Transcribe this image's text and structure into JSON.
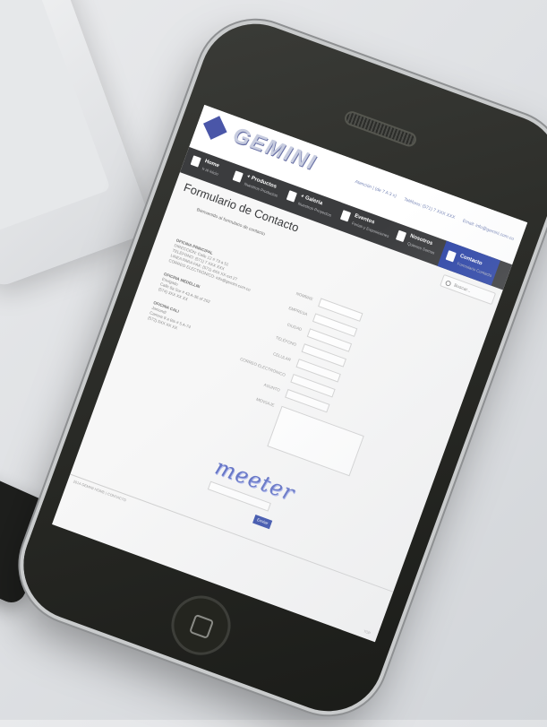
{
  "site": {
    "brand": "GEMINI",
    "header_info": [
      "Atención | (de 7 A 3 x)",
      "Teléfono: (571) 7 XXX XXX",
      "Email: info@gemini.com.co"
    ],
    "search_placeholder": "Buscar...",
    "page_title": "Formulario de Contacto",
    "welcome": "Bienvenido al formulario de contacto"
  },
  "nav": [
    {
      "label": "Home",
      "sub": "Ir al inicio"
    },
    {
      "label": "+ Productos",
      "sub": "Nuestros Productos"
    },
    {
      "label": "+ Galeria",
      "sub": "Nuestros Proyectos"
    },
    {
      "label": "Eventos",
      "sub": "Ferias y Exposiciones"
    },
    {
      "label": "Nosotros",
      "sub": "Quienes Somos"
    },
    {
      "label": "Contacto",
      "sub": "Formulario Contacto"
    }
  ],
  "offices": [
    {
      "title": "OFICINA PRINCIPAL",
      "lines": [
        "DIRECCIÓN: Calle 12 # 73 a 51",
        "TELÉFONO: (571) 7 XXX XXX",
        "LINEA PARA FAX: (571) 4XX XX ext 27",
        "CORREO ELECTRÓNICO: info@gemini.com.co"
      ]
    },
    {
      "title": "OFICINA MEDELLIN",
      "lines": [
        "Envigado",
        "Calle 8a Sur # 43 A-36 of 202",
        "(574) 3XX XX XX"
      ]
    },
    {
      "title": "OFICINA CALI",
      "lines": [
        "Jamundí",
        "Carrera 9 a Bis # 5 A-74",
        "(572) 5XX XX XX"
      ]
    }
  ],
  "form": {
    "fields": [
      "NOMBRE",
      "EMPRESA",
      "CIUDAD",
      "TELÉFONO",
      "CELULAR",
      "CORREO ELECTRÓNICO",
      "ASUNTO",
      "MENSAJE"
    ],
    "captcha": "meeter",
    "submit": "Enviar"
  },
  "footer": {
    "text": "2014 GEMINI HOME  |  CONTACTO",
    "top": "TOP"
  },
  "colors": {
    "accent": "#2f47a8",
    "nav_bg": "#3b3c3e",
    "phone_body": "#262723"
  }
}
